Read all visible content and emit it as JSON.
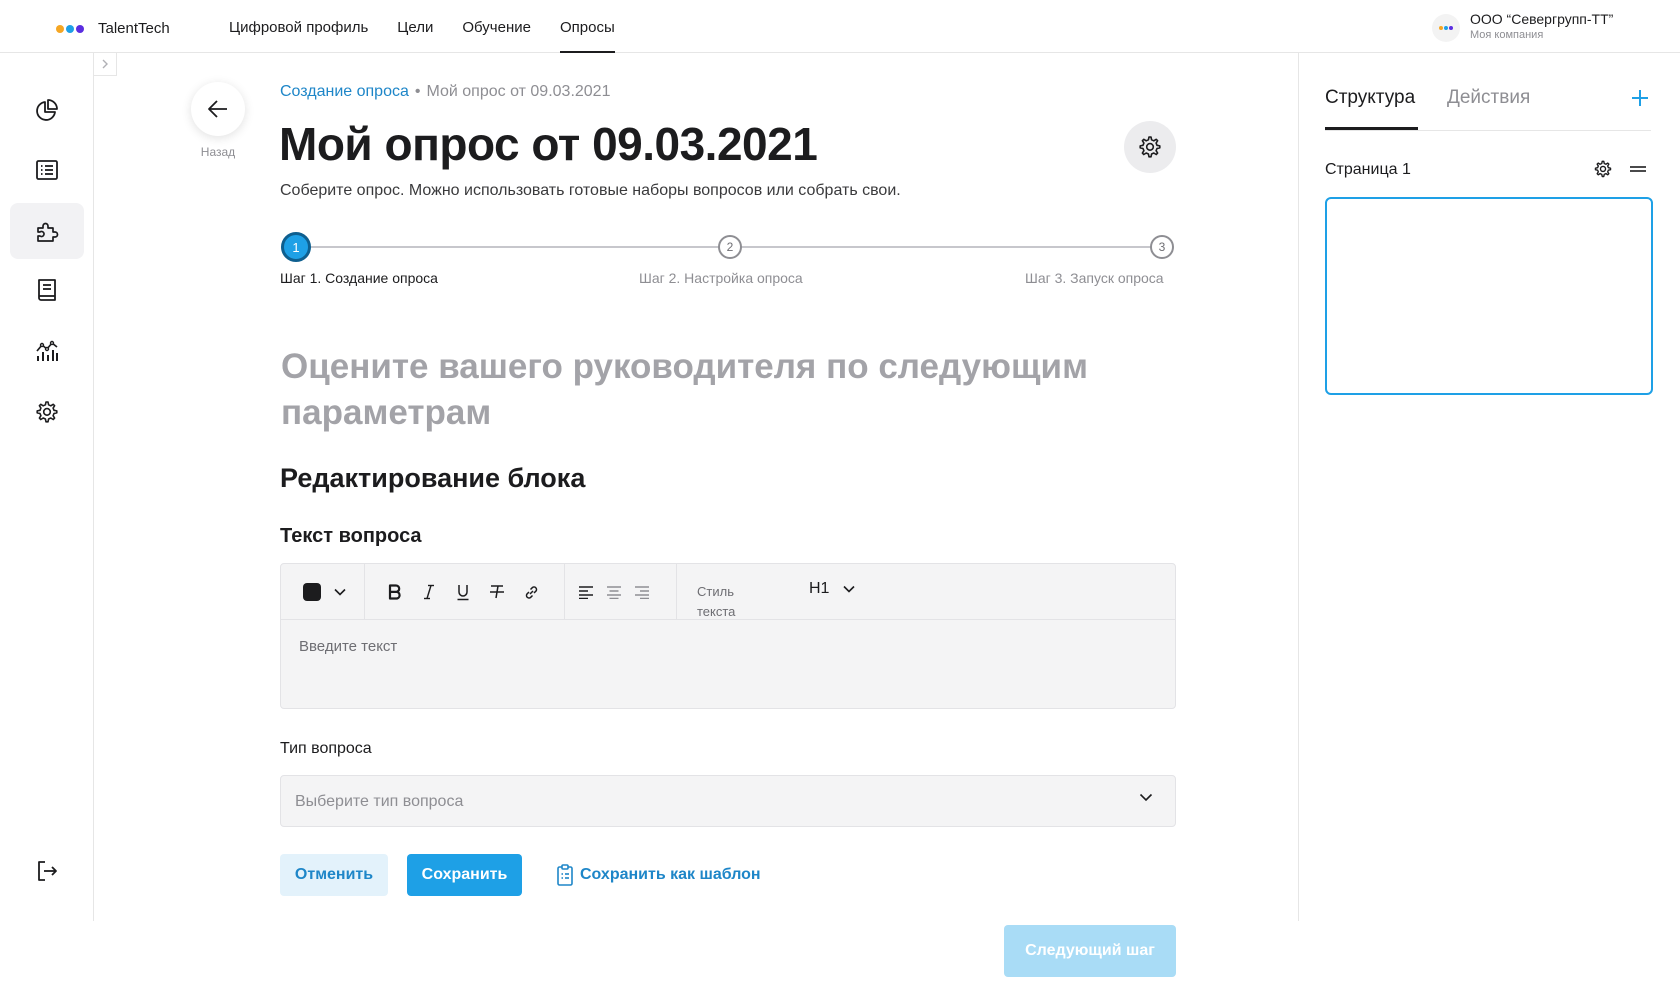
{
  "app": {
    "name": "TalentTech",
    "logo_colors": [
      "#f5a623",
      "#1ea0e6",
      "#5b2ee0"
    ]
  },
  "nav": {
    "items": [
      {
        "label": "Цифровой профиль"
      },
      {
        "label": "Цели"
      },
      {
        "label": "Обучение"
      },
      {
        "label": "Опросы",
        "active": true
      }
    ]
  },
  "company": {
    "name": "ООО “Севергрупп-ТТ”",
    "subtitle": "Моя компания"
  },
  "sidebar": {
    "items": [
      {
        "icon": "pie-chart-icon"
      },
      {
        "icon": "list-icon"
      },
      {
        "icon": "puzzle-icon",
        "active": true
      },
      {
        "icon": "book-icon"
      },
      {
        "icon": "analytics-icon"
      },
      {
        "icon": "gear-icon"
      }
    ],
    "logout_icon": "logout-icon"
  },
  "header": {
    "back_label": "Назад",
    "breadcrumb_link": "Создание опроса",
    "breadcrumb_sep": "•",
    "breadcrumb_current": "Мой опрос от 09.03.2021",
    "title": "Мой опрос от 09.03.2021",
    "subtitle": "Соберите опрос. Можно использовать готовые наборы вопросов или собрать свои."
  },
  "stepper": {
    "steps": [
      {
        "number": "1",
        "label": "Шаг 1. Создание опроса",
        "active": true
      },
      {
        "number": "2",
        "label": "Шаг 2. Настройка опроса"
      },
      {
        "number": "3",
        "label": "Шаг 3. Запуск опроса"
      }
    ]
  },
  "question": {
    "title": "Оцените вашего руководителя по следующим параметрам"
  },
  "block": {
    "title": "Редактирование блока",
    "question_text_label": "Текст вопроса",
    "editor_placeholder": "Введите текст",
    "style_label": "Стиль текста",
    "style_value": "H1",
    "type_label": "Тип вопроса",
    "type_placeholder": "Выберите тип вопроса"
  },
  "actions": {
    "cancel": "Отменить",
    "save": "Сохранить",
    "save_template": "Сохранить как шаблон",
    "next": "Следующий шаг"
  },
  "right_panel": {
    "tabs": [
      {
        "label": "Структура",
        "active": true
      },
      {
        "label": "Действия"
      }
    ],
    "page_label": "Страница 1"
  },
  "colors": {
    "accent": "#1ea0e6",
    "accent_dark": "#1e86c8",
    "accent_light": "#e3f2fb",
    "disabled": "#a9dcf6"
  }
}
